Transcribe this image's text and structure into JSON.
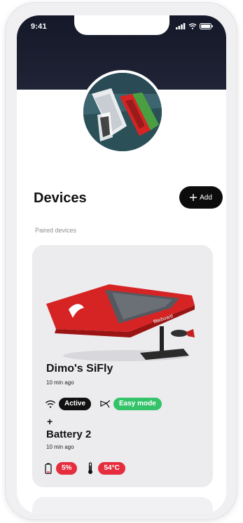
{
  "status_bar": {
    "time": "9:41"
  },
  "page": {
    "title": "Devices"
  },
  "actions": {
    "add_label": "Add"
  },
  "sections": {
    "paired_label": "Paired devices"
  },
  "device": {
    "name": "Dimo's SiFly",
    "last_seen": "10 min ago",
    "connection_status": "Active",
    "mode": "Easy mode",
    "icons": {
      "connection": "wifi-icon",
      "mode": "propeller-icon"
    }
  },
  "separator": {
    "symbol": "+"
  },
  "battery": {
    "name": "Battery 2",
    "last_seen": "10 min ago",
    "charge": "5%",
    "temperature": "54°C",
    "icons": {
      "charge": "battery-icon",
      "temperature": "thermometer-icon"
    }
  },
  "colors": {
    "active_pill": "#111111",
    "mode_pill": "#35c36a",
    "alert_pill": "#e52d3d",
    "primary_button": "#0c0c0c",
    "board_red": "#d62424"
  }
}
